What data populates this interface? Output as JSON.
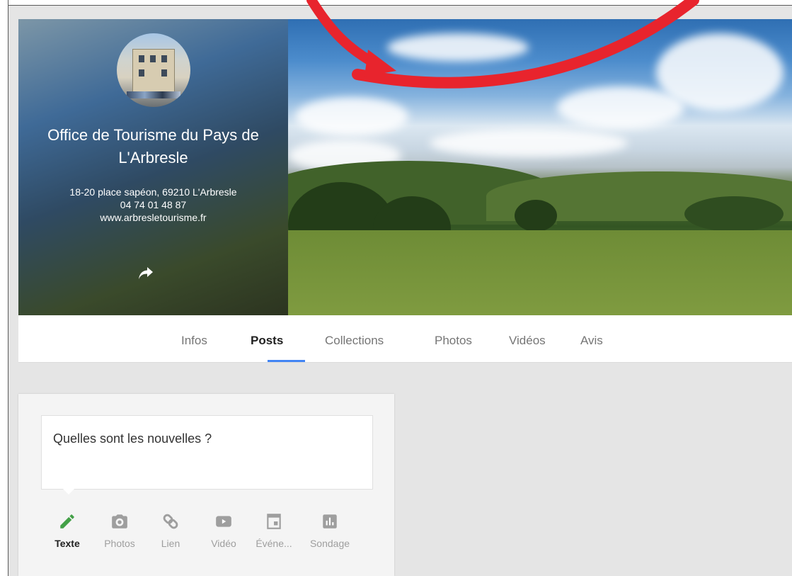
{
  "profile": {
    "name": "Office de Tourisme du Pays de L'Arbresle",
    "address": "18-20 place sapéon, 69210 L'Arbresle",
    "phone": "04 74 01 48 87",
    "website": "www.arbresletourisme.fr",
    "share_icon": "share-arrow-icon"
  },
  "tabs": [
    {
      "label": "Infos",
      "active": false
    },
    {
      "label": "Posts",
      "active": true
    },
    {
      "label": "Collections",
      "active": false
    },
    {
      "label": "Photos",
      "active": false
    },
    {
      "label": "Vidéos",
      "active": false
    },
    {
      "label": "Avis",
      "active": false
    }
  ],
  "compose": {
    "placeholder": "Quelles sont les nouvelles ?",
    "actions": [
      {
        "label": "Texte",
        "icon": "pencil-icon",
        "active": true
      },
      {
        "label": "Photos",
        "icon": "camera-icon",
        "active": false
      },
      {
        "label": "Lien",
        "icon": "link-icon",
        "active": false
      },
      {
        "label": "Vidéo",
        "icon": "video-icon",
        "active": false
      },
      {
        "label": "Événe...",
        "icon": "calendar-icon",
        "active": false
      },
      {
        "label": "Sondage",
        "icon": "poll-icon",
        "active": false
      }
    ]
  },
  "colors": {
    "accent": "#4285f4",
    "active_icon": "#43a047",
    "annotation": "#e8242d",
    "page_bg": "#e5e5e5"
  }
}
